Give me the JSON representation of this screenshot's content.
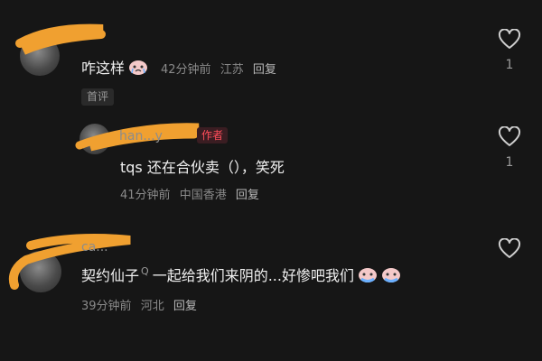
{
  "comments": [
    {
      "name": "",
      "text": "咋这样",
      "time": "42分钟前",
      "location": "江苏",
      "reply_label": "回复",
      "tag": "首评",
      "likes": "1"
    },
    {
      "name": "han...y",
      "author_badge": "作者",
      "text": "tqs 还在合伙卖（），笑死",
      "time": "41分钟前",
      "location": "中国香港",
      "reply_label": "回复",
      "likes": "1"
    },
    {
      "name": "ca...",
      "text_before": "契约仙子",
      "search_mark": "Q",
      "text_after": "一起给我们来阴的...好惨吧我们",
      "time": "39分钟前",
      "location": "河北",
      "reply_label": "回复",
      "likes": ""
    }
  ],
  "icons": {
    "like": "heart-outline-icon",
    "emoji": "crying-face-emoji"
  },
  "colors": {
    "background": "#161616",
    "author_badge": "#ff4d5a",
    "scribble": "#f0a030"
  }
}
